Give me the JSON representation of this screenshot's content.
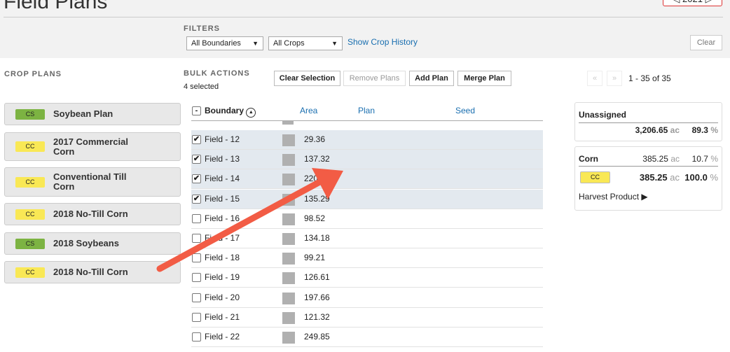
{
  "header": {
    "title": "Field Plans",
    "year": "2021"
  },
  "filters": {
    "label": "FILTERS",
    "boundaries": "All Boundaries",
    "crops": "All Crops",
    "show_history": "Show Crop History",
    "clear": "Clear"
  },
  "crop_plans": {
    "label": "CROP PLANS",
    "items": [
      {
        "badge": "CS",
        "name": "Soybean Plan",
        "type": "cs"
      },
      {
        "badge": "CC",
        "name": "2017 Commercial Corn",
        "type": "cc"
      },
      {
        "badge": "CC",
        "name": "Conventional Till Corn",
        "type": "cc"
      },
      {
        "badge": "CC",
        "name": "2018 No-Till Corn",
        "type": "cc"
      },
      {
        "badge": "CS",
        "name": "2018 Soybeans",
        "type": "cs"
      },
      {
        "badge": "CC",
        "name": "2018 No-Till Corn",
        "type": "cc"
      }
    ]
  },
  "bulk": {
    "label": "BULK ACTIONS",
    "selected": "4 selected",
    "clear_selection": "Clear Selection",
    "remove_plans": "Remove Plans",
    "add_plan": "Add Plan",
    "merge_plan": "Merge Plan"
  },
  "pagination": {
    "prev": "«",
    "next": "»",
    "range": "1 - 35 of 35"
  },
  "table": {
    "columns": [
      "Boundary",
      "Area",
      "Plan",
      "Seed"
    ],
    "rows": [
      {
        "name": "Field - 12",
        "area": "29.36",
        "checked": true
      },
      {
        "name": "Field - 13",
        "area": "137.32",
        "checked": true
      },
      {
        "name": "Field - 14",
        "area": "220.3",
        "checked": true
      },
      {
        "name": "Field - 15",
        "area": "135.29",
        "checked": true
      },
      {
        "name": "Field - 16",
        "area": "98.52",
        "checked": false
      },
      {
        "name": "Field - 17",
        "area": "134.18",
        "checked": false
      },
      {
        "name": "Field - 18",
        "area": "99.21",
        "checked": false
      },
      {
        "name": "Field - 19",
        "area": "126.61",
        "checked": false
      },
      {
        "name": "Field - 20",
        "area": "197.66",
        "checked": false
      },
      {
        "name": "Field - 21",
        "area": "121.32",
        "checked": false
      },
      {
        "name": "Field - 22",
        "area": "249.85",
        "checked": false
      }
    ]
  },
  "summary": {
    "unassigned": {
      "label": "Unassigned",
      "acres": "3,206.65",
      "unit": "ac",
      "pct": "89.3",
      "pct_unit": "%"
    },
    "corn": {
      "label": "Corn",
      "acres": "385.25",
      "pct": "10.7",
      "badge": "CC",
      "plan_acres": "385.25",
      "plan_pct": "100.0",
      "harvest": "Harvest Product ▶"
    }
  },
  "colors": {
    "accent": "#1a6fb0",
    "selected_row": "#e3e9ef",
    "arrow": "#f25c45",
    "soy": "#7cb342",
    "corn": "#f9e855"
  }
}
